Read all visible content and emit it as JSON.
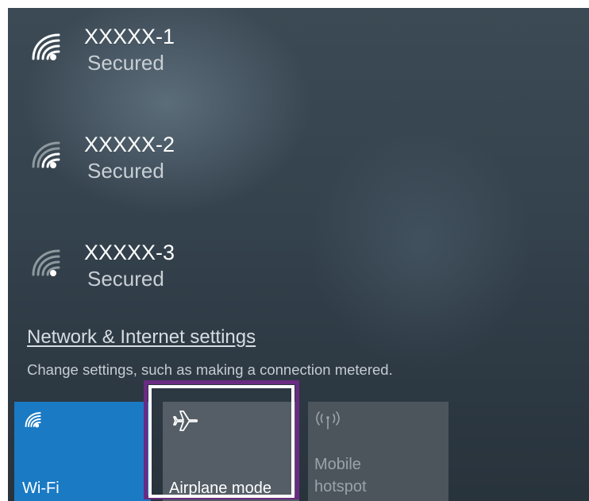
{
  "networks": [
    {
      "ssid": "XXXXX-1",
      "status": "Secured",
      "signal_icon": "wifi-signal-icon"
    },
    {
      "ssid": "XXXXX-2",
      "status": "Secured",
      "signal_icon": "wifi-signal-icon"
    },
    {
      "ssid": "XXXXX-3",
      "status": "Secured",
      "signal_icon": "wifi-signal-icon"
    }
  ],
  "settings": {
    "link_text": "Network & Internet settings",
    "description": "Change settings, such as making a connection metered."
  },
  "quick_actions": [
    {
      "label": "Wi-Fi",
      "icon": "wifi-icon",
      "state": "on",
      "color": "#1a7ac4"
    },
    {
      "label": "Airplane mode",
      "icon": "airplane-icon",
      "state": "off",
      "highlighted": true
    },
    {
      "label": "Mobile\nhotspot",
      "icon": "mobile-hotspot-icon",
      "state": "disabled"
    }
  ],
  "colors": {
    "accent": "#1a7ac4",
    "highlight_outer": "#6a2b83",
    "highlight_inner": "#ffffff"
  }
}
